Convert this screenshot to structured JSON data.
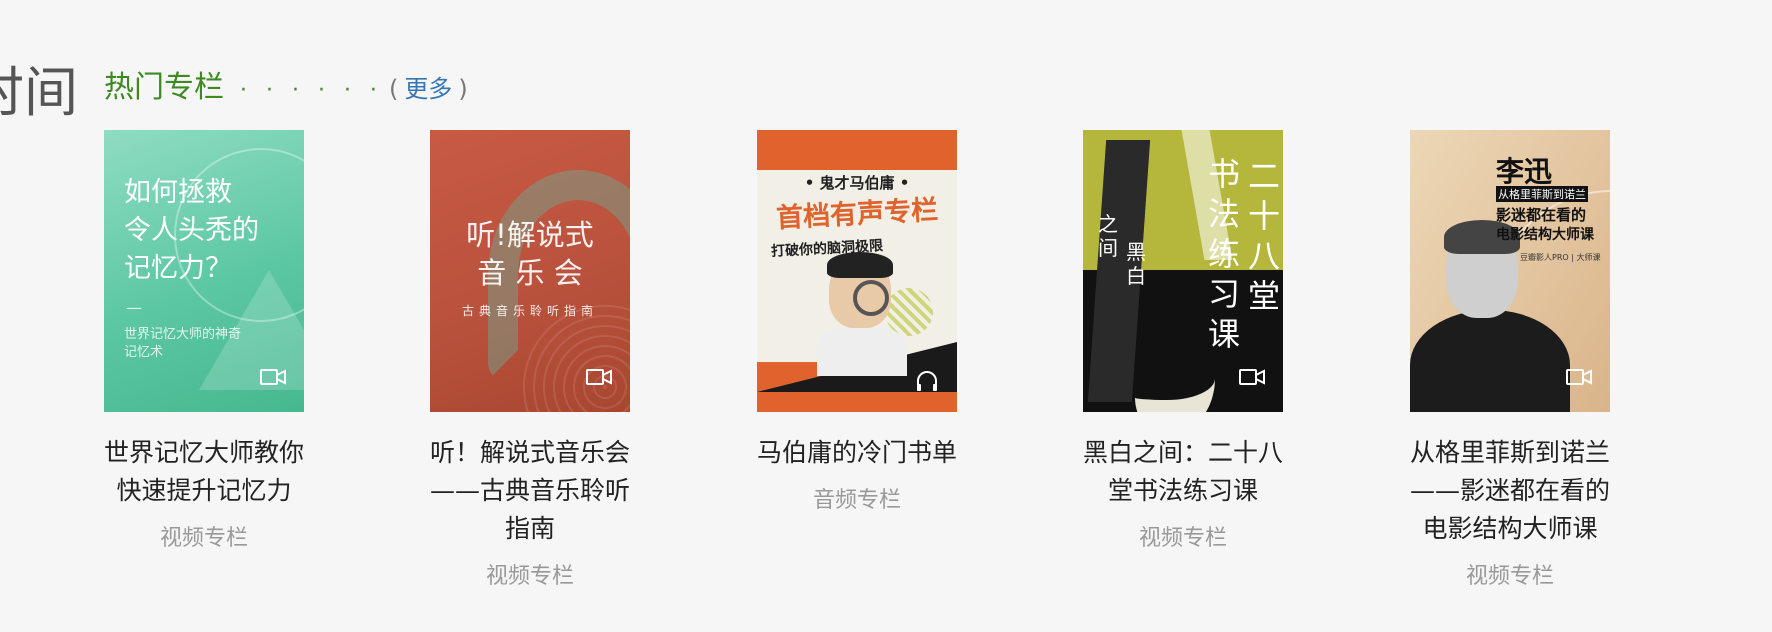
{
  "page_left_fragment": "时间",
  "section": {
    "title": "热门专栏",
    "dots": "· · · · · ·",
    "more_open": "(",
    "more_label": "更多",
    "more_close": ")"
  },
  "cards": [
    {
      "title": "世界记忆大师教你快速提升记忆力",
      "type": "视频专栏",
      "cover": {
        "lines": [
          "如何拯救",
          "令人头秃的",
          "记忆力？"
        ],
        "dash": "—",
        "sub1": "世界记忆大师的神奇",
        "sub2": "记忆术",
        "icon": "video-icon"
      }
    },
    {
      "title": "听！解说式音乐会——古典音乐聆听指南",
      "type": "视频专栏",
      "cover": {
        "line1": "听!解说式",
        "line2": "音 乐 会",
        "sub": "古典音乐聆听指南",
        "icon": "video-icon"
      }
    },
    {
      "title": "马伯庸的冷门书单",
      "type": "音频专栏",
      "cover": {
        "kicker": "• 鬼才马伯庸 •",
        "headline": "首档有声专栏",
        "sub": "打破你的脑洞极限",
        "icon": "headphones-icon"
      }
    },
    {
      "title": "黑白之间：二十八堂书法练习课",
      "type": "视频专栏",
      "cover": {
        "col1": "二十八堂",
        "col2": "书法练习课",
        "small1": "之间",
        "small2": "黑白",
        "icon": "video-icon"
      }
    },
    {
      "title": "从格里菲斯到诺兰——影迷都在看的电影结构大师课",
      "type": "视频专栏",
      "cover": {
        "name": "李迅",
        "sub1": "从格里菲斯到诺兰",
        "sub2": "影迷都在看的",
        "sub3": "电影结构大师课",
        "brand": "豆瓣影人PRO | 大师课",
        "icon": "video-icon"
      }
    }
  ]
}
